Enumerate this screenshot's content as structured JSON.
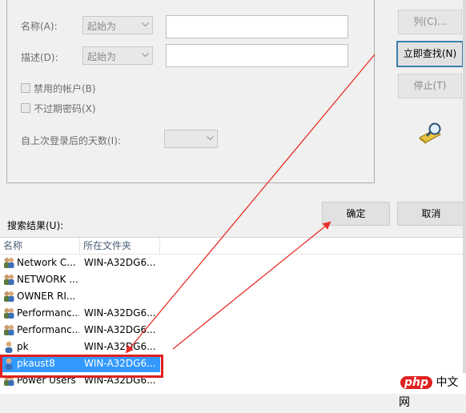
{
  "form": {
    "name_label": "名称(A):",
    "name_match": "起始为",
    "desc_label": "描述(D):",
    "desc_match": "起始为",
    "disabled_label": "禁用的帐户(B)",
    "noexpire_label": "不过期密码(X)",
    "days_label": "自上次登录后的天数(I):",
    "days_value": ""
  },
  "side_buttons": {
    "columns": "列(C)...",
    "find_now": "立即查找(N)",
    "stop": "停止(T)"
  },
  "dialog_buttons": {
    "ok": "确定",
    "cancel": "取消"
  },
  "results": {
    "label": "搜索结果(U):",
    "columns": [
      "名称",
      "所在文件夹"
    ],
    "rows": [
      {
        "name": "Network C...",
        "folder": "WIN-A32DG6..."
      },
      {
        "name": "NETWORK ...",
        "folder": ""
      },
      {
        "name": "OWNER RI...",
        "folder": ""
      },
      {
        "name": "Performanc...",
        "folder": "WIN-A32DG6..."
      },
      {
        "name": "Performanc...",
        "folder": "WIN-A32DG6..."
      },
      {
        "name": "pk",
        "folder": "WIN-A32DG6..."
      },
      {
        "name": "pkaust8",
        "folder": "WIN-A32DG6..."
      },
      {
        "name": "Power Users",
        "folder": "WIN-A32DG6..."
      }
    ],
    "selected_index": 6
  },
  "watermark": {
    "badge": "php",
    "text": "中文网"
  },
  "colors": {
    "selection": "#3399ff",
    "highlight_box": "#e02020",
    "arrow": "#e8302a"
  }
}
